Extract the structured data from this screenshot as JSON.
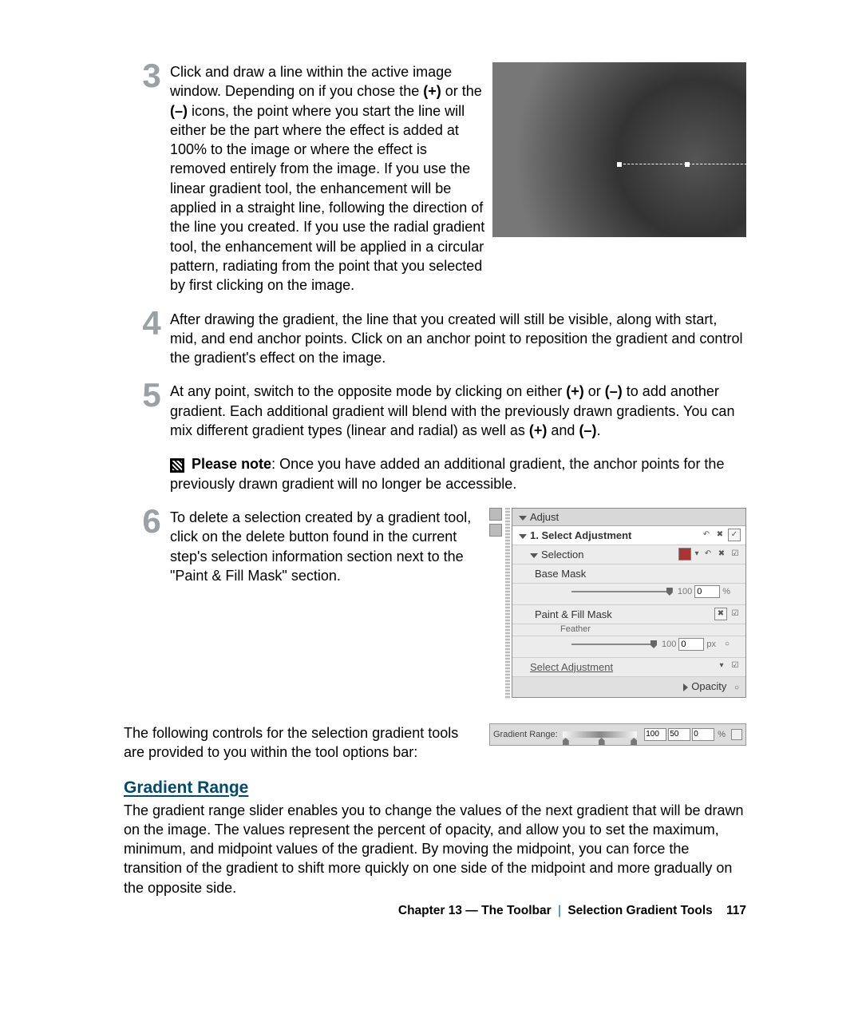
{
  "steps": {
    "3": {
      "num": "3",
      "body_a": "Click and draw a line within the active image window. Depending on if you chose the ",
      "plus": "(+)",
      "body_b": " or the ",
      "minus": "(–)",
      "body_c": " icons, the point where you start the line will either be the part where the effect is added at 100% to the image or where the effect is removed entirely from the image. If you use the linear gradient tool, the enhancement will be applied in a straight line, following the direction of the line you created. If you use the radial gradient tool, the enhancement will be applied in a circular pattern, radiating from the point that you selected by first clicking on the image."
    },
    "4": {
      "num": "4",
      "body": "After drawing the gradient, the line that you created will still be visible, along with start, mid, and end anchor points. Click on an anchor point to reposition the gradient and control the gradient's effect on the image."
    },
    "5": {
      "num": "5",
      "body_a": "At any point, switch to the opposite mode by clicking on either ",
      "plus": "(+)",
      "body_b": " or ",
      "minus": "(–)",
      "body_c": " to add another gradient. Each additional gradient will blend with the previously drawn gradients. You can mix different gradient types (linear and radial) as well as ",
      "plus2": "(+)",
      "body_d": " and ",
      "minus2": "(–)",
      "body_e": "."
    },
    "6": {
      "num": "6",
      "body": "To delete a selection created by a gradient tool, click on the delete button found in the current step's selection information section next to the \"Paint & Fill Mask\" section."
    }
  },
  "note": {
    "label": "Please note",
    "body": ": Once you have added an additional gradient, the anchor points for the previously drawn gradient will no longer be accessible."
  },
  "panel": {
    "header": "Adjust",
    "select_adj": "1. Select Adjustment",
    "selection": "Selection",
    "base_mask": "Base Mask",
    "base_val_left": "100",
    "base_val_box": "0",
    "base_unit": "%",
    "paint_fill": "Paint & Fill Mask",
    "feather": "Feather",
    "feather_left": "100",
    "feather_box": "0",
    "feather_unit": "px",
    "select_adj2": "Select Adjustment",
    "opacity": "Opacity"
  },
  "below": "The following controls for the selection gradient tools are provided to you within the tool options bar:",
  "gr_bar": {
    "label": "Gradient Range:",
    "v1": "100",
    "v2": "50",
    "v3": "0",
    "unit": "%"
  },
  "section_title": "Gradient Range",
  "section_body": "The gradient range slider enables you to change the values of the next gradient that will be drawn on the image. The values represent the percent of opacity, and allow you to set the maximum, minimum, and midpoint values of the gradient. By moving the midpoint, you can force the transition of the gradient to shift more quickly on one side of the midpoint and more gradually on the opposite side.",
  "footer": {
    "chapter": "Chapter 13 — The Toolbar",
    "sub": "Selection Gradient Tools",
    "page": "117"
  }
}
